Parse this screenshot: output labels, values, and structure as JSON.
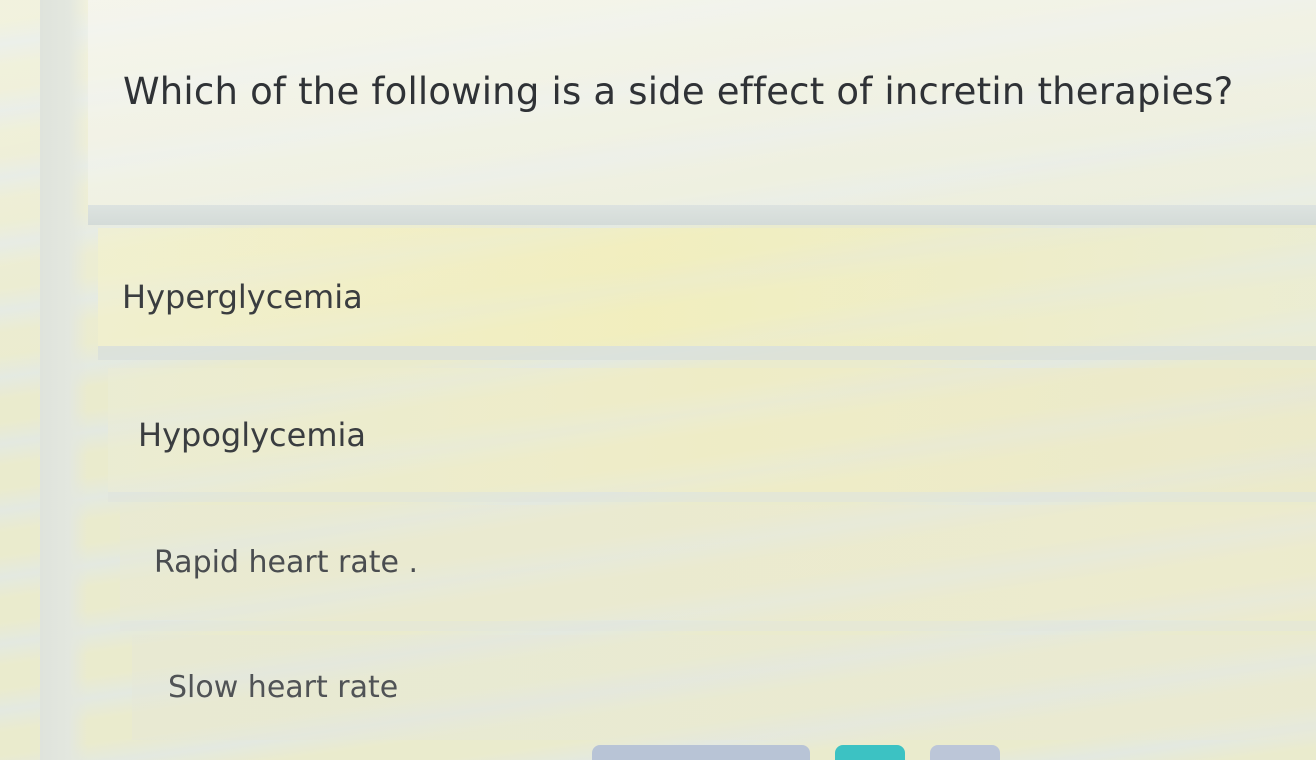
{
  "question": {
    "text": "Which of the following is a side effect of incretin therapies?"
  },
  "options": [
    {
      "label": "Hyperglycemia"
    },
    {
      "label": "Hypoglycemia"
    },
    {
      "label": "Rapid heart rate ."
    },
    {
      "label": "Slow heart rate"
    }
  ],
  "colors": {
    "accent": "#3cc2c3",
    "secondary_button": "#b8c4d6",
    "text": "#2f3236"
  }
}
